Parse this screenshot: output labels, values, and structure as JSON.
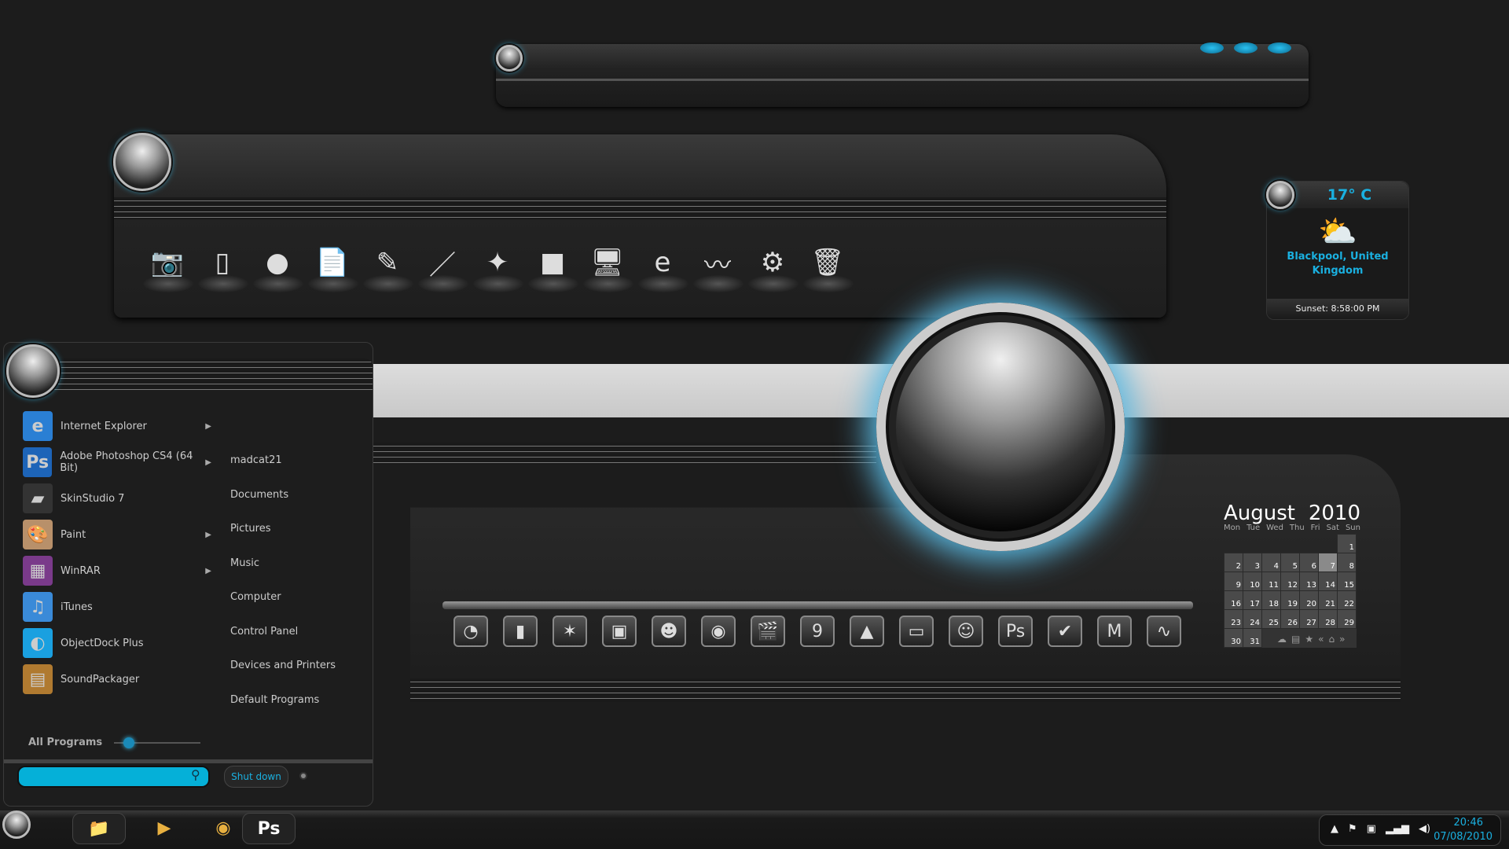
{
  "weather": {
    "temperature": "17° C",
    "location": "Blackpool, United Kingdom",
    "sunset": "Sunset: 8:58:00 PM",
    "icon": "partly-cloudy-icon"
  },
  "top_dock": {
    "icons": [
      "camera-icon",
      "xbox-icon",
      "media-orb-icon",
      "notepad-icon",
      "tools-icon",
      "ruler-icon",
      "shuriken-icon",
      "camcorder-icon",
      "monitor-icon",
      "internet-explorer-icon",
      "genie-lamp-icon",
      "gear-icon",
      "trash-icon"
    ],
    "glyphs": [
      "📷",
      "▯",
      "●",
      "📄",
      "✎",
      "／",
      "✦",
      "■",
      "🖥",
      "e",
      "〰",
      "⚙",
      "🗑"
    ]
  },
  "bottom_dock": {
    "icons": [
      "dashboard-icon",
      "iphone-icon",
      "avast-icon",
      "slideshow-icon",
      "angry-bird-icon",
      "firefox-icon",
      "clapper-icon",
      "calendar-icon",
      "stamp-icon",
      "tv-icon",
      "finder-icon",
      "photoshop-icon",
      "tasks-icon",
      "gmail-icon",
      "activity-monitor-icon"
    ],
    "glyphs": [
      "◔",
      "▮",
      "✶",
      "▣",
      "☻",
      "◉",
      "🎬",
      "9",
      "▲",
      "▭",
      "☺",
      "Ps",
      "✔",
      "M",
      "∿"
    ]
  },
  "calendar": {
    "month": "August",
    "year": "2010",
    "weekdays": [
      "Mon",
      "Tue",
      "Wed",
      "Thu",
      "Fri",
      "Sat",
      "Sun"
    ],
    "weeks": [
      [
        "",
        "",
        "",
        "",
        "",
        "",
        "1"
      ],
      [
        "2",
        "3",
        "4",
        "5",
        "6",
        "7",
        "8"
      ],
      [
        "9",
        "10",
        "11",
        "12",
        "13",
        "14",
        "15"
      ],
      [
        "16",
        "17",
        "18",
        "19",
        "20",
        "21",
        "22"
      ],
      [
        "23",
        "24",
        "25",
        "26",
        "27",
        "28",
        "29"
      ],
      [
        "30",
        "31",
        "",
        "",
        "",
        "",
        ""
      ]
    ],
    "today": "7",
    "toolbar": [
      "☁",
      "▤",
      "★",
      "«",
      "⌂",
      "»"
    ]
  },
  "start_menu": {
    "programs": [
      {
        "label": "Internet Explorer",
        "glyph": "e",
        "color": "#2a7fd4",
        "submenu": true
      },
      {
        "label": "Adobe Photoshop CS4 (64 Bit)",
        "glyph": "Ps",
        "color": "#1d64b8",
        "submenu": true
      },
      {
        "label": "SkinStudio 7",
        "glyph": "▰",
        "color": "#333",
        "submenu": false
      },
      {
        "label": "Paint",
        "glyph": "🎨",
        "color": "#b8906a",
        "submenu": true
      },
      {
        "label": "WinRAR",
        "glyph": "▦",
        "color": "#7a3a8a",
        "submenu": true
      },
      {
        "label": "iTunes",
        "glyph": "♫",
        "color": "#3a8ad8",
        "submenu": false
      },
      {
        "label": "ObjectDock Plus",
        "glyph": "◐",
        "color": "#1aa0e0",
        "submenu": false
      },
      {
        "label": "SoundPackager",
        "glyph": "▤",
        "color": "#b07a30",
        "submenu": false
      }
    ],
    "places": [
      "madcat21",
      "Documents",
      "Pictures",
      "Music",
      "Computer",
      "Control Panel",
      "Devices and Printers",
      "Default Programs"
    ],
    "all_programs": "All Programs",
    "search_placeholder": "",
    "shutdown": "Shut down"
  },
  "taskbar": {
    "apps": [
      "explorer-icon",
      "media-player-icon",
      "media-center-icon",
      "photoshop-icon"
    ],
    "glyphs": [
      "📁",
      "▶",
      "◉",
      "Ps"
    ],
    "time": "20:46",
    "date": "07/08/2010",
    "tray": [
      "show-hidden-icons",
      "action-center-flag-icon",
      "power-icon",
      "network-signal-icon",
      "volume-icon"
    ],
    "tray_glyphs": [
      "▲",
      "⚑",
      "▣",
      "▂▄▆",
      "◀)"
    ]
  },
  "accent": "#1ab0e0"
}
